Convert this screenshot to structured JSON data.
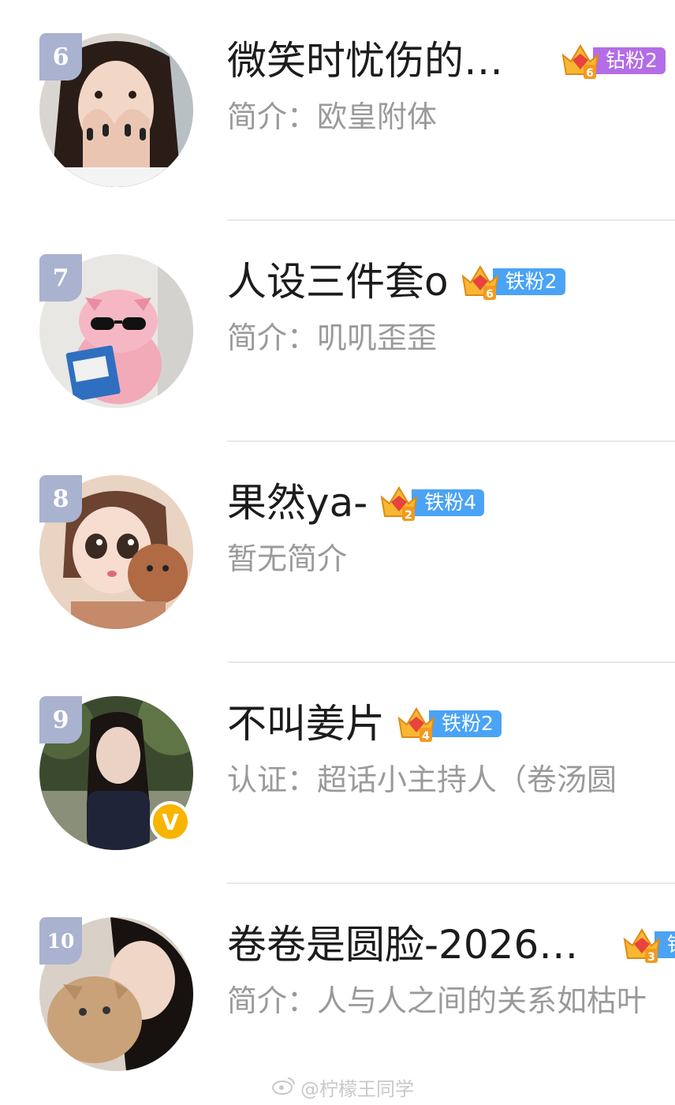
{
  "colors": {
    "rank_bg": "#a9b2cf",
    "diamond_pill": "#b36de6",
    "iron_pill": "#4aa3f5",
    "crown_gold": "#f7b733",
    "verified_badge": "#f7b500"
  },
  "rows": [
    {
      "rank": "6",
      "name": "微笑时忧伤的…",
      "badge": {
        "level": "6",
        "label": "钻粉2",
        "type": "diamond"
      },
      "desc": "简介：欧皇附体"
    },
    {
      "rank": "7",
      "name": "人设三件套o",
      "badge": {
        "level": "6",
        "label": "铁粉2",
        "type": "iron"
      },
      "desc": "简介：叽叽歪歪"
    },
    {
      "rank": "8",
      "name": "果然ya-",
      "badge": {
        "level": "2",
        "label": "铁粉4",
        "type": "iron"
      },
      "desc": "暂无简介"
    },
    {
      "rank": "9",
      "name": "不叫姜片",
      "badge": {
        "level": "4",
        "label": "铁粉2",
        "type": "iron"
      },
      "desc": "认证：超话小主持人（卷汤圆",
      "verified": "V"
    },
    {
      "rank": "10",
      "name": "卷卷是圆脸-2026…",
      "badge": {
        "level": "3",
        "label": "铁",
        "type": "iron"
      },
      "desc": "简介：人与人之间的关系如枯叶"
    }
  ],
  "watermark": {
    "icon": "weibo-icon",
    "text": "@柠檬王同学"
  }
}
